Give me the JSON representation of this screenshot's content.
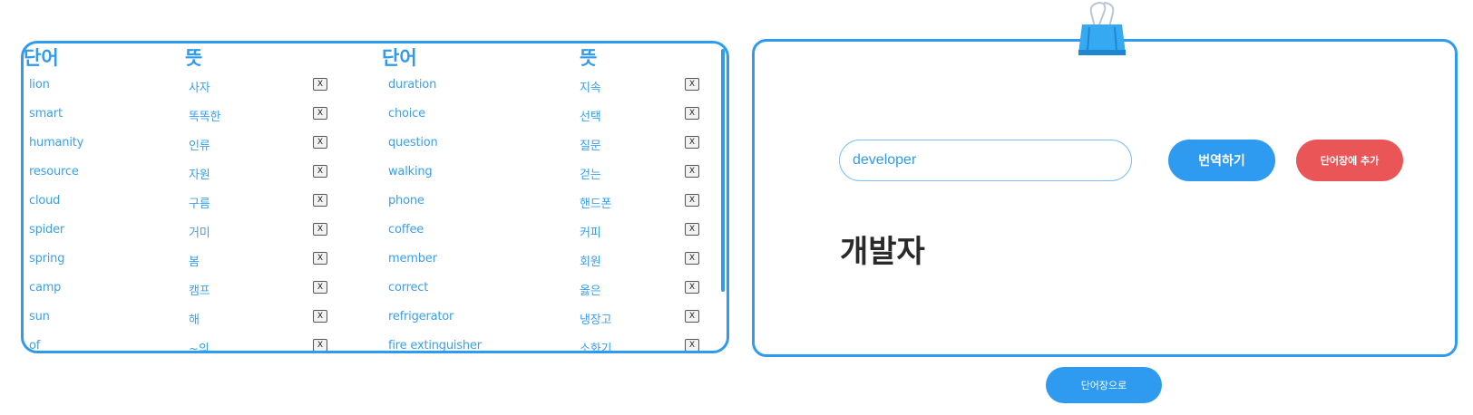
{
  "vocab": {
    "headers": {
      "word": "단어",
      "meaning": "뜻"
    },
    "delete_label": "X",
    "left_rows": [
      {
        "word": "lion",
        "meaning": "사자"
      },
      {
        "word": "smart",
        "meaning": "똑똑한"
      },
      {
        "word": "humanity",
        "meaning": "인류"
      },
      {
        "word": "resource",
        "meaning": "자원"
      },
      {
        "word": "cloud",
        "meaning": "구름"
      },
      {
        "word": "spider",
        "meaning": "거미"
      },
      {
        "word": "spring",
        "meaning": "봄"
      },
      {
        "word": "camp",
        "meaning": "캠프"
      },
      {
        "word": "sun",
        "meaning": "해"
      },
      {
        "word": "of",
        "meaning": "~의"
      }
    ],
    "right_rows": [
      {
        "word": "duration",
        "meaning": "지속"
      },
      {
        "word": "choice",
        "meaning": "선택"
      },
      {
        "word": "question",
        "meaning": "질문"
      },
      {
        "word": "walking",
        "meaning": "걷는"
      },
      {
        "word": "phone",
        "meaning": "핸드폰"
      },
      {
        "word": "coffee",
        "meaning": "커피"
      },
      {
        "word": "member",
        "meaning": "회원"
      },
      {
        "word": "correct",
        "meaning": "옳은"
      },
      {
        "word": "refrigerator",
        "meaning": "냉장고"
      },
      {
        "word": "fire extinguisher",
        "meaning": "소화기"
      }
    ]
  },
  "translator": {
    "input_value": "developer",
    "translate_label": "번역하기",
    "add_label": "단어장에 추가",
    "result": "개발자"
  },
  "nav": {
    "goto_label": "단어장으로"
  },
  "colors": {
    "accent": "#2f9bf0",
    "danger": "#ea5557",
    "text_dark": "#2a2a2a"
  },
  "icons": {
    "clip": "binder-clip-icon"
  }
}
